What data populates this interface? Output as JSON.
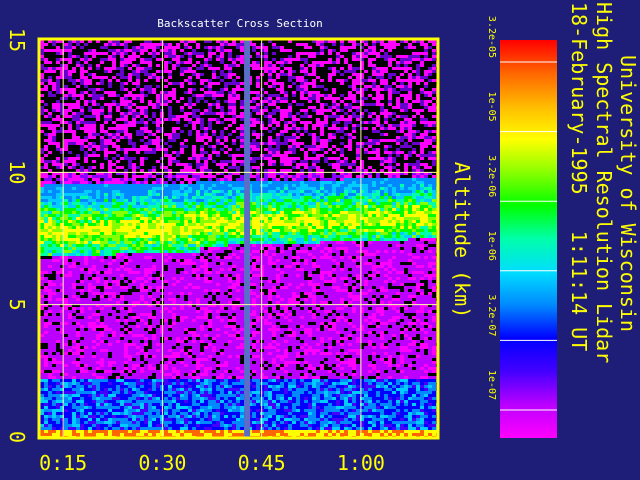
{
  "chart_data": {
    "type": "heatmap",
    "title": "Backscatter Cross Section",
    "ylabel": "Altitude (km)",
    "xlabel": "",
    "x_ticks": [
      "0:15",
      "0:30",
      "0:45",
      "1:00"
    ],
    "y_ticks": [
      "0",
      "5",
      "10",
      "15"
    ],
    "ylim": [
      0,
      15
    ],
    "x_tick_minutes": [
      15,
      30,
      45,
      60
    ],
    "xlim_minutes": [
      11.5,
      71.5
    ],
    "grid": true,
    "data_gap_minutes": 42.8,
    "layers_km": {
      "cloud_base": [
        6.8,
        7.3
      ],
      "cloud_top": [
        9.5,
        9.8
      ],
      "boundary_layer_top": 2.2,
      "noise_above": 10.0
    },
    "colorbar": {
      "tick_labels": [
        "3.2e-05",
        "1e-05",
        "3.2e-06",
        "1e-06",
        "3.2e-07",
        "1e-07"
      ],
      "colors": [
        "#ff00ff",
        "#bb00ff",
        "#4400ff",
        "#0000ff",
        "#0088ff",
        "#00ddff",
        "#00ffaa",
        "#00ff00",
        "#88ff00",
        "#ffff00",
        "#ffbb00",
        "#ff6600",
        "#ff0000"
      ]
    },
    "header_lines": [
      "University of Wisconsin",
      "High Spectral Resolution Lidar",
      "18-February-1995   1:11:14 UT"
    ],
    "colors": {
      "background": "#1e1e78",
      "axes": "#ffff00",
      "title": "#ffffff"
    }
  }
}
